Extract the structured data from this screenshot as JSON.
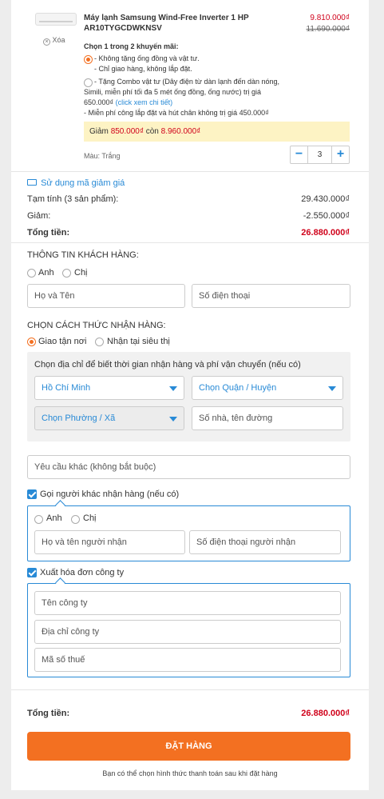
{
  "product": {
    "name": "Máy lạnh Samsung Wind-Free Inverter 1 HP AR10TYGCDWKNSV",
    "price": "9.810.000₫",
    "old_price": "11.690.000₫",
    "remove_label": "Xóa",
    "promo_title": "Chọn 1 trong 2 khuyến mãi:",
    "promo1_line1": "- Không tặng ống đồng và vật tư.",
    "promo1_line2": "- Chỉ giao hàng, không lắp đặt.",
    "promo2_line1": "- Tặng Combo vật tư (Dây điện từ dàn lạnh đến dàn nóng,",
    "promo2_line2": "Simili, miễn phí tối đa 5 mét ống đồng, ống nước) trị giá",
    "promo2_line3_prefix": "650.000₫",
    "promo2_link": "(click xem chi tiết)",
    "promo2_line4": "- Miễn phí công lắp đặt và hút chân không trị giá 450.000₫",
    "discount_prefix": "Giảm",
    "discount_amount": "850.000₫",
    "discount_mid": "còn",
    "discount_final": "8.960.000₫",
    "color_label": "Màu: Trắng",
    "quantity": "3",
    "minus": "−",
    "plus": "+"
  },
  "summary": {
    "coupon_label": "Sử dụng mã giảm giá",
    "subtotal_label": "Tạm tính (3 sản phẩm):",
    "subtotal_value": "29.430.000₫",
    "discount_label": "Giảm:",
    "discount_value": "-2.550.000₫",
    "total_label": "Tổng tiền:",
    "total_value": "26.880.000₫"
  },
  "customer": {
    "heading": "THÔNG TIN KHÁCH HÀNG:",
    "mr": "Anh",
    "ms": "Chị",
    "name_placeholder": "Họ và Tên",
    "phone_placeholder": "Số điện thoại"
  },
  "delivery": {
    "heading": "CHỌN CÁCH THỨC NHẬN HÀNG:",
    "home": "Giao tận nơi",
    "store": "Nhận tại siêu thị",
    "address_hint": "Chọn địa chỉ để biết thời gian nhận hàng và phí vận chuyển (nếu có)",
    "city": "Hồ Chí Minh",
    "district": "Chọn Quận / Huyện",
    "ward": "Chọn Phường / Xã",
    "street_placeholder": "Số nhà, tên đường"
  },
  "other_request_placeholder": "Yêu cầu khác (không bắt buộc)",
  "receiver": {
    "label": "Gọi người khác nhận hàng (nếu có)",
    "mr": "Anh",
    "ms": "Chị",
    "name_placeholder": "Họ và tên người nhận",
    "phone_placeholder": "Số điện thoại người nhận"
  },
  "invoice": {
    "label": "Xuất hóa đơn công ty",
    "company_placeholder": "Tên công ty",
    "address_placeholder": "Địa chỉ công ty",
    "tax_placeholder": "Mã số thuế"
  },
  "footer": {
    "total_label": "Tổng tiền:",
    "total_value": "26.880.000₫",
    "order_button": "ĐẶT HÀNG",
    "note": "Bạn có thể chọn hình thức thanh toán sau khi đặt hàng"
  },
  "colors": {
    "accent": "#288ad6",
    "price": "#d0021b",
    "button": "#f37021"
  }
}
